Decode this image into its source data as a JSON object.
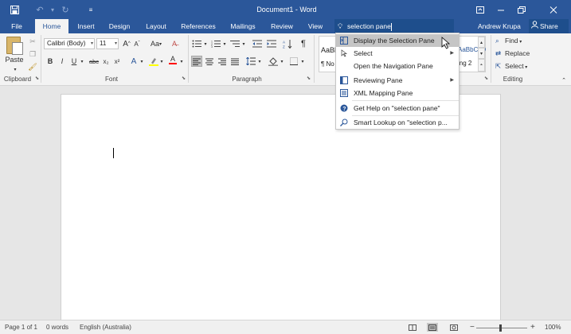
{
  "titlebar": {
    "title": "Document1 - Word",
    "save_icon": "save-icon",
    "undo_icon": "undo-icon",
    "redo_icon": "redo-icon",
    "customize_icon": "customize-qat-icon"
  },
  "tabs": {
    "file": "File",
    "home": "Home",
    "insert": "Insert",
    "design": "Design",
    "layout": "Layout",
    "references": "References",
    "mailings": "Mailings",
    "review": "Review",
    "view": "View"
  },
  "tellme": {
    "value": "selection pane"
  },
  "user": {
    "name": "Andrew Krupa",
    "share": "Share"
  },
  "ribbon": {
    "clipboard": {
      "label": "Clipboard",
      "paste": "Paste"
    },
    "font": {
      "label": "Font",
      "font_name": "Calibri (Body)",
      "font_size": "11",
      "grow": "A",
      "shrink": "A",
      "case": "Aa",
      "bold": "B",
      "italic": "I",
      "underline": "U",
      "strike": "abc",
      "subscript": "x₂",
      "superscript": "x²",
      "effects": "A",
      "color": "A"
    },
    "paragraph": {
      "label": "Paragraph",
      "pilcrow": "¶"
    },
    "styles": {
      "sample1": "AaBl",
      "sample1_name": "¶ No",
      "sample2": "AaBbCcD",
      "sample2_name": "ing 2"
    },
    "editing": {
      "label": "Editing",
      "find": "Find",
      "replace": "Replace",
      "select": "Select"
    }
  },
  "dropdown": {
    "items": [
      {
        "label": "Display the Selection Pane",
        "icon": "selection-pane-icon",
        "submenu": false,
        "highlighted": true
      },
      {
        "label": "Select",
        "icon": "select-icon",
        "submenu": true,
        "highlighted": false
      },
      {
        "label": "Open the Navigation Pane",
        "icon": "",
        "submenu": false,
        "highlighted": false
      },
      {
        "label": "Reviewing Pane",
        "icon": "reviewing-pane-icon",
        "submenu": true,
        "highlighted": false
      },
      {
        "label": "XML Mapping Pane",
        "icon": "xml-mapping-icon",
        "submenu": false,
        "highlighted": false
      },
      {
        "label": "Get Help on \"selection pane\"",
        "icon": "help-icon",
        "submenu": false,
        "highlighted": false
      },
      {
        "label": "Smart Lookup on \"selection p...",
        "icon": "smart-lookup-icon",
        "submenu": false,
        "highlighted": false
      }
    ]
  },
  "statusbar": {
    "page": "Page 1 of 1",
    "words": "0 words",
    "language": "English (Australia)",
    "zoom_minus": "−",
    "zoom_plus": "+",
    "zoom": "100%"
  },
  "colors": {
    "brand": "#2b579a",
    "ribbon_bg": "#f3f3f3",
    "highlight_yellow": "#ffff00",
    "font_red": "#ff0000"
  }
}
